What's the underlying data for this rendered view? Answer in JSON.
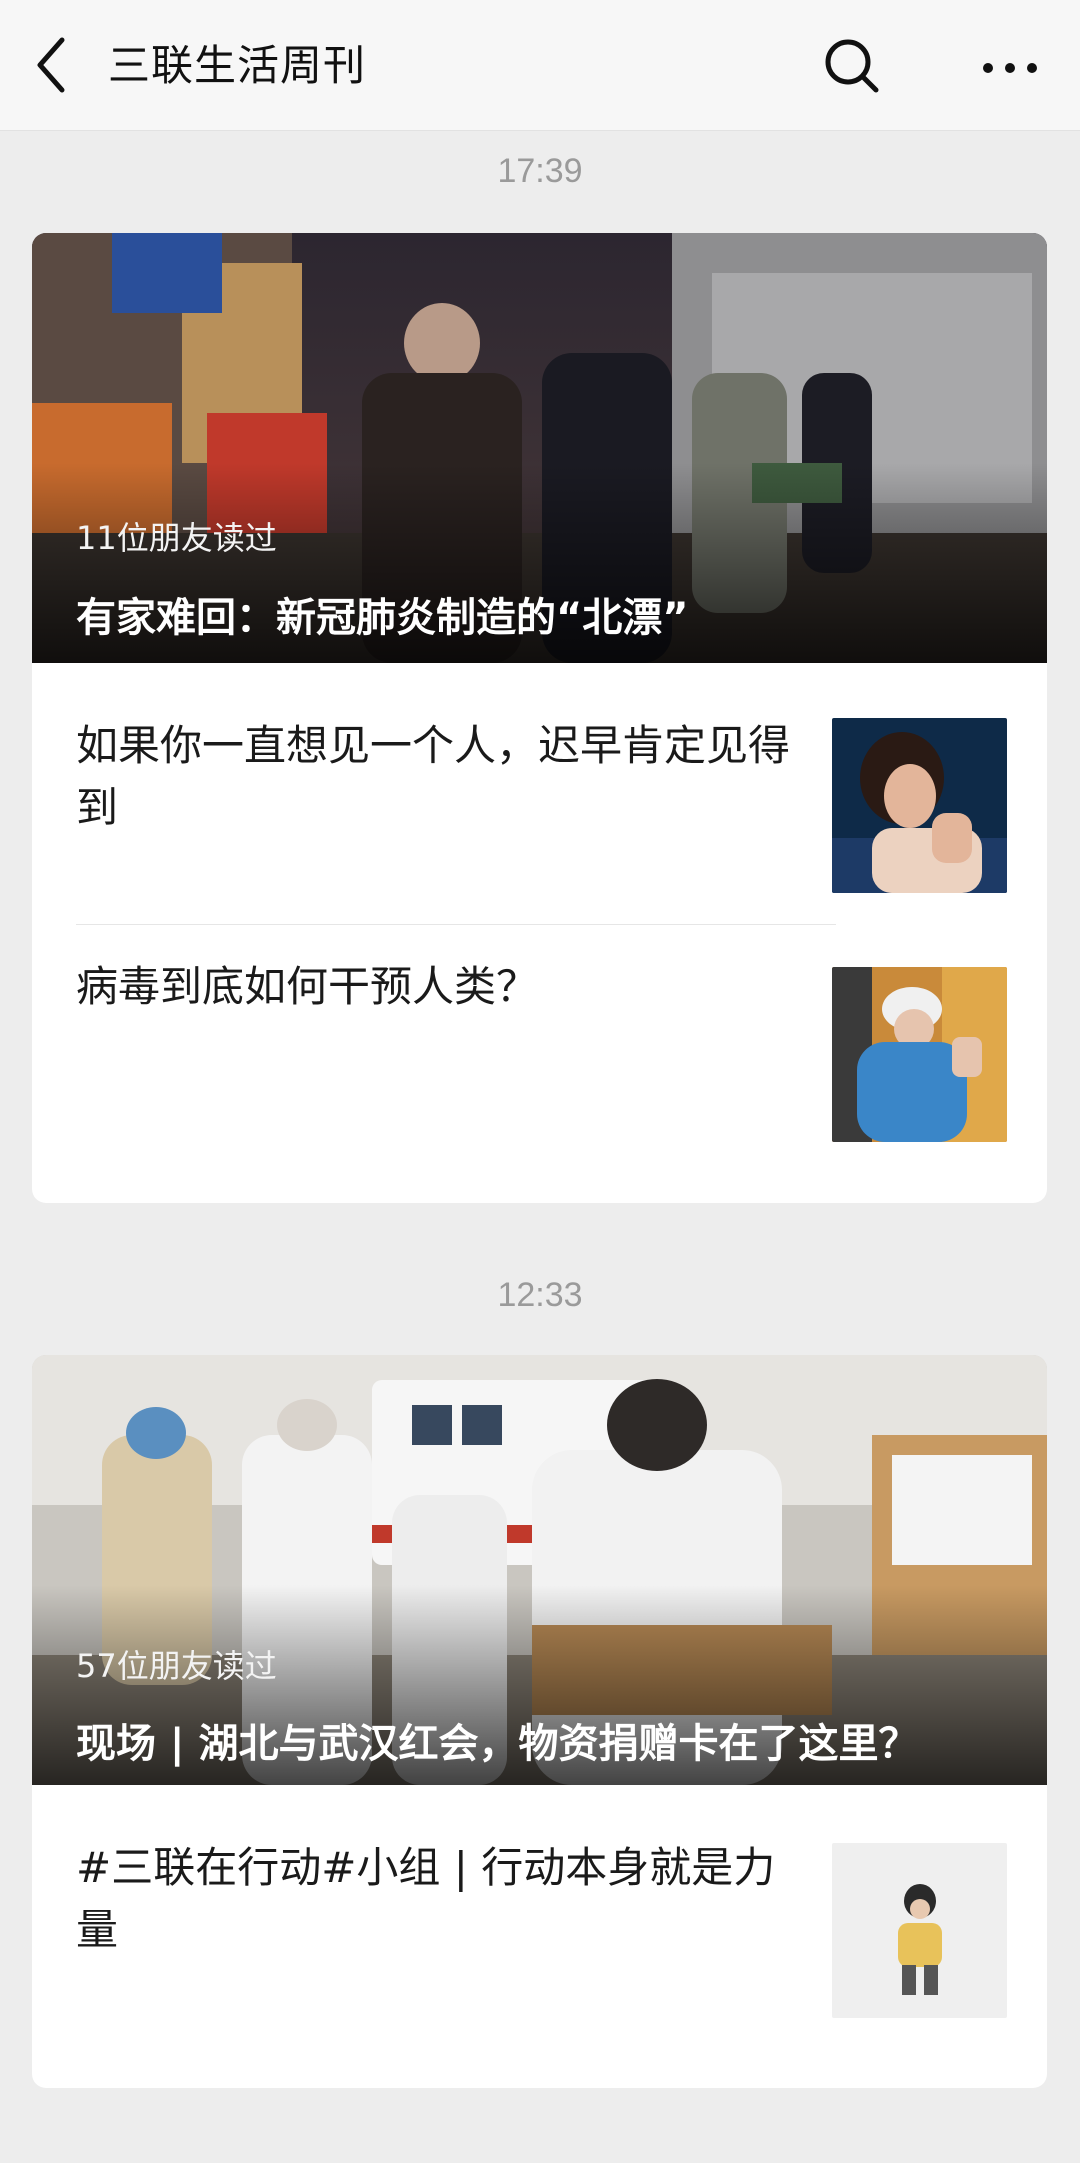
{
  "header": {
    "title": "三联生活周刊"
  },
  "icons": {
    "back": "back-arrow-icon",
    "search": "search-icon",
    "more": "more-icon"
  },
  "messages": [
    {
      "time": "17:39",
      "hero": {
        "readers": "11位朋友读过",
        "title": "有家难回：新冠肺炎制造的“北漂”"
      },
      "items": [
        {
          "title": "如果你一直想见一个人，迟早肯定见得到"
        },
        {
          "title": "病毒到底如何干预人类？"
        }
      ]
    },
    {
      "time": "12:33",
      "hero": {
        "readers": "57位朋友读过",
        "title": "现场 | 湖北与武汉红会，物资捐赠卡在了这里？"
      },
      "items": [
        {
          "title": "#三联在行动#小组 | 行动本身就是力量"
        }
      ]
    }
  ],
  "colors": {
    "background": "#ededed",
    "card": "#ffffff",
    "time_text": "#9a9a9a"
  }
}
